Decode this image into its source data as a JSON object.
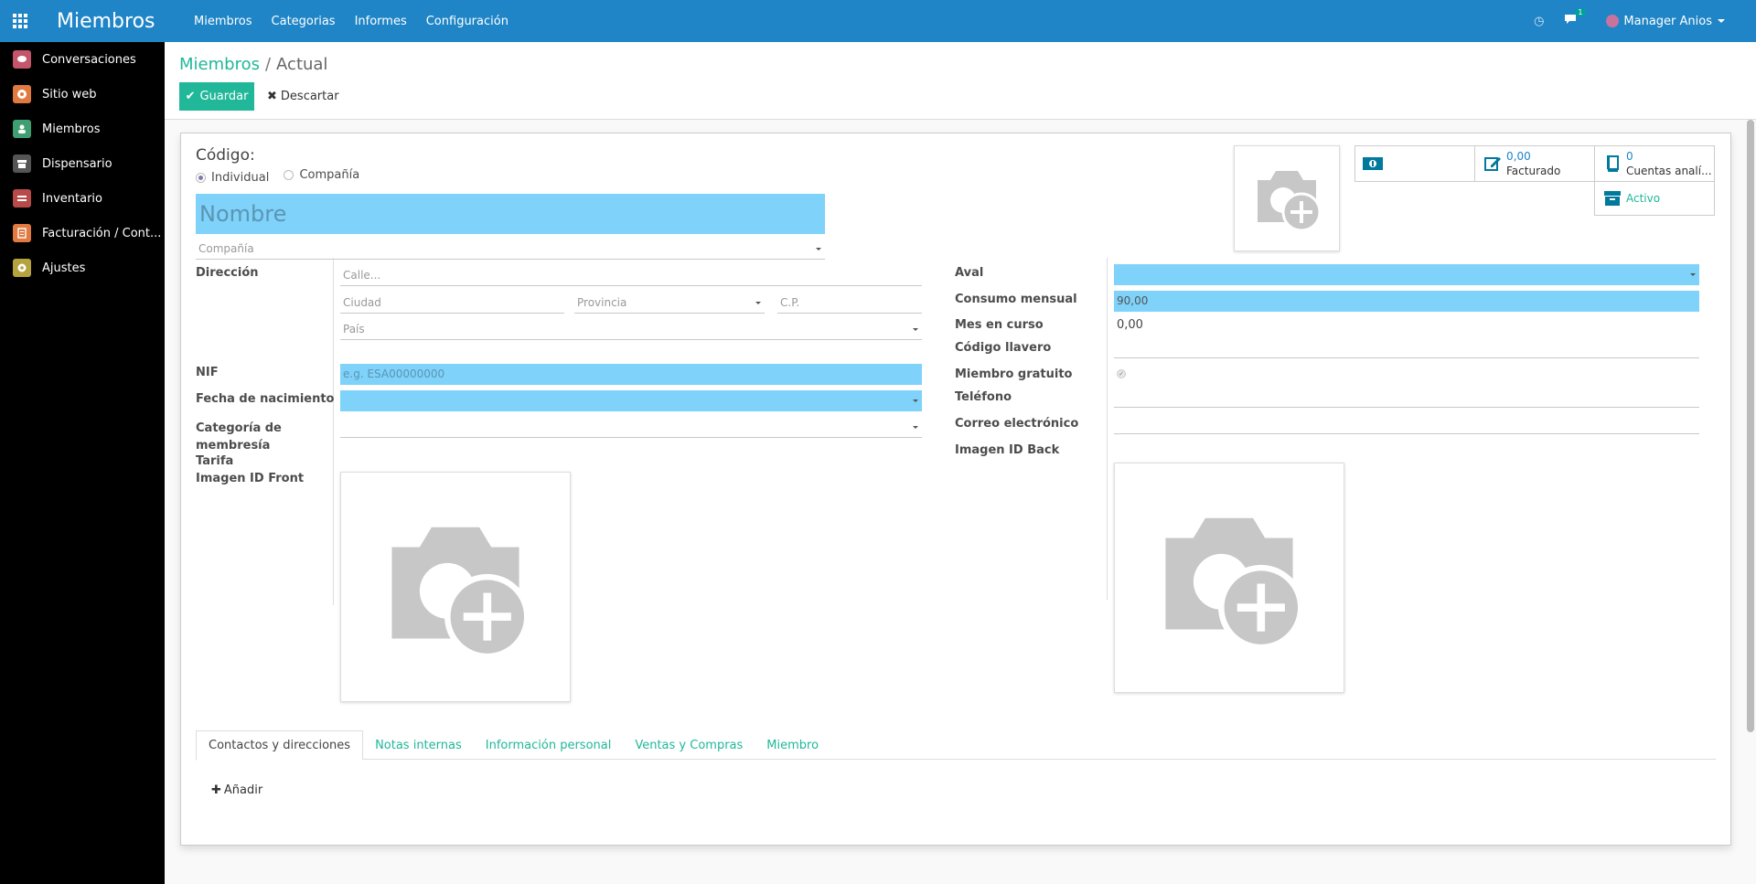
{
  "app": {
    "title": "Miembros",
    "menu": [
      "Miembros",
      "Categorias",
      "Informes",
      "Configuración"
    ],
    "chat_count": "1",
    "user": "Manager Anios"
  },
  "sidebar": {
    "items": [
      {
        "label": "Conversaciones",
        "icon": "chat-icon",
        "color": "#c4556b"
      },
      {
        "label": "Sitio web",
        "icon": "globe-icon",
        "color": "#e07a40"
      },
      {
        "label": "Miembros",
        "icon": "person-icon",
        "color": "#3f9f72"
      },
      {
        "label": "Dispensario",
        "icon": "store-icon",
        "color": "#555555"
      },
      {
        "label": "Inventario",
        "icon": "boxes-icon",
        "color": "#b84a4a"
      },
      {
        "label": "Facturación / Cont...",
        "icon": "invoice-icon",
        "color": "#e07a40"
      },
      {
        "label": "Ajustes",
        "icon": "gear-icon",
        "color": "#b5a33e"
      }
    ]
  },
  "breadcrumb": {
    "parent": "Miembros",
    "separator": "/",
    "current": "Actual"
  },
  "actions": {
    "save": "Guardar",
    "discard": "Descartar"
  },
  "form": {
    "code_label": "Código:",
    "type_options": [
      "Individual",
      "Compañía"
    ],
    "name_placeholder": "Nombre",
    "company_placeholder": "Compañía",
    "left": {
      "address_label": "Dirección",
      "street_placeholder": "Calle...",
      "city_placeholder": "Ciudad",
      "state_placeholder": "Provincia",
      "zip_placeholder": "C.P.",
      "country_placeholder": "País",
      "nif_label": "NIF",
      "nif_placeholder": "e.g. ESA00000000",
      "birthdate_label": "Fecha de nacimiento",
      "category_label": "Categoría de membresía",
      "tarifa_label": "Tarifa",
      "id_front_label": "Imagen ID Front"
    },
    "right": {
      "aval_label": "Aval",
      "monthly_label": "Consumo mensual",
      "monthly_value": "90,00",
      "current_month_label": "Mes en curso",
      "current_month_value": "0,00",
      "key_code_label": "Código llavero",
      "free_member_label": "Miembro gratuito",
      "phone_label": "Teléfono",
      "email_label": "Correo electrónico",
      "id_back_label": "Imagen ID Back"
    }
  },
  "stats": {
    "invoiced_value": "0,00",
    "invoiced_label": "Facturado",
    "accounts_value": "0",
    "accounts_label": "Cuentas analí...",
    "active_label": "Activo"
  },
  "tabs": [
    "Contactos y direcciones",
    "Notas internas",
    "Información personal",
    "Ventas y Compras",
    "Miembro"
  ],
  "add_label": "Añadir"
}
